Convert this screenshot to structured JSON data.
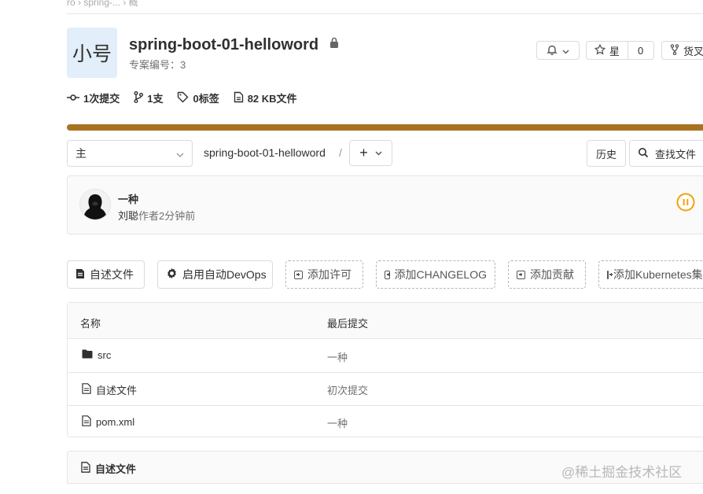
{
  "top_breadcrumb": "ro › spring-... › 概",
  "project": {
    "avatar_text": "小号",
    "title": "spring-boot-01-helloword",
    "id_label": "专案编号：3"
  },
  "actions": {
    "notification_icon": "bell-icon",
    "star_label": "星",
    "star_count": "0",
    "fork_label": "货叉"
  },
  "stats": {
    "commits": "1次提交",
    "branches": "1支",
    "tags": "0标签",
    "size": "82 KB文件"
  },
  "colors": {
    "progress_bar": "#a8721f",
    "pipeline": "#f0a30a",
    "avatar_bg": "#e2eef9"
  },
  "repo_nav": {
    "branch": "主",
    "path": "spring-boot-01-helloword",
    "separator": "/",
    "add_label": "+",
    "history_button": "历史",
    "find_file_button": "查找文件"
  },
  "last_commit": {
    "title": "一种",
    "author": "刘聪",
    "meta": "作者2分钟前",
    "status": "paused"
  },
  "quick_actions": {
    "readme": "自述文件",
    "autodevops": "启用自动DevOps",
    "license": "添加许可",
    "changelog": "添加CHANGELOG",
    "contributing": "添加贡献",
    "kubernetes": "添加Kubernetes集群"
  },
  "file_table": {
    "headers": {
      "name": "名称",
      "last_commit": "最后提交"
    },
    "rows": [
      {
        "name": "src",
        "commit": "一种",
        "icon": "folder-icon"
      },
      {
        "name": "自述文件",
        "commit": "初次提交",
        "icon": "file-icon"
      },
      {
        "name": "pom.xml",
        "commit": "一种",
        "icon": "file-icon"
      }
    ]
  },
  "readme": {
    "title": "自述文件"
  },
  "watermark": "@稀土掘金技术社区"
}
